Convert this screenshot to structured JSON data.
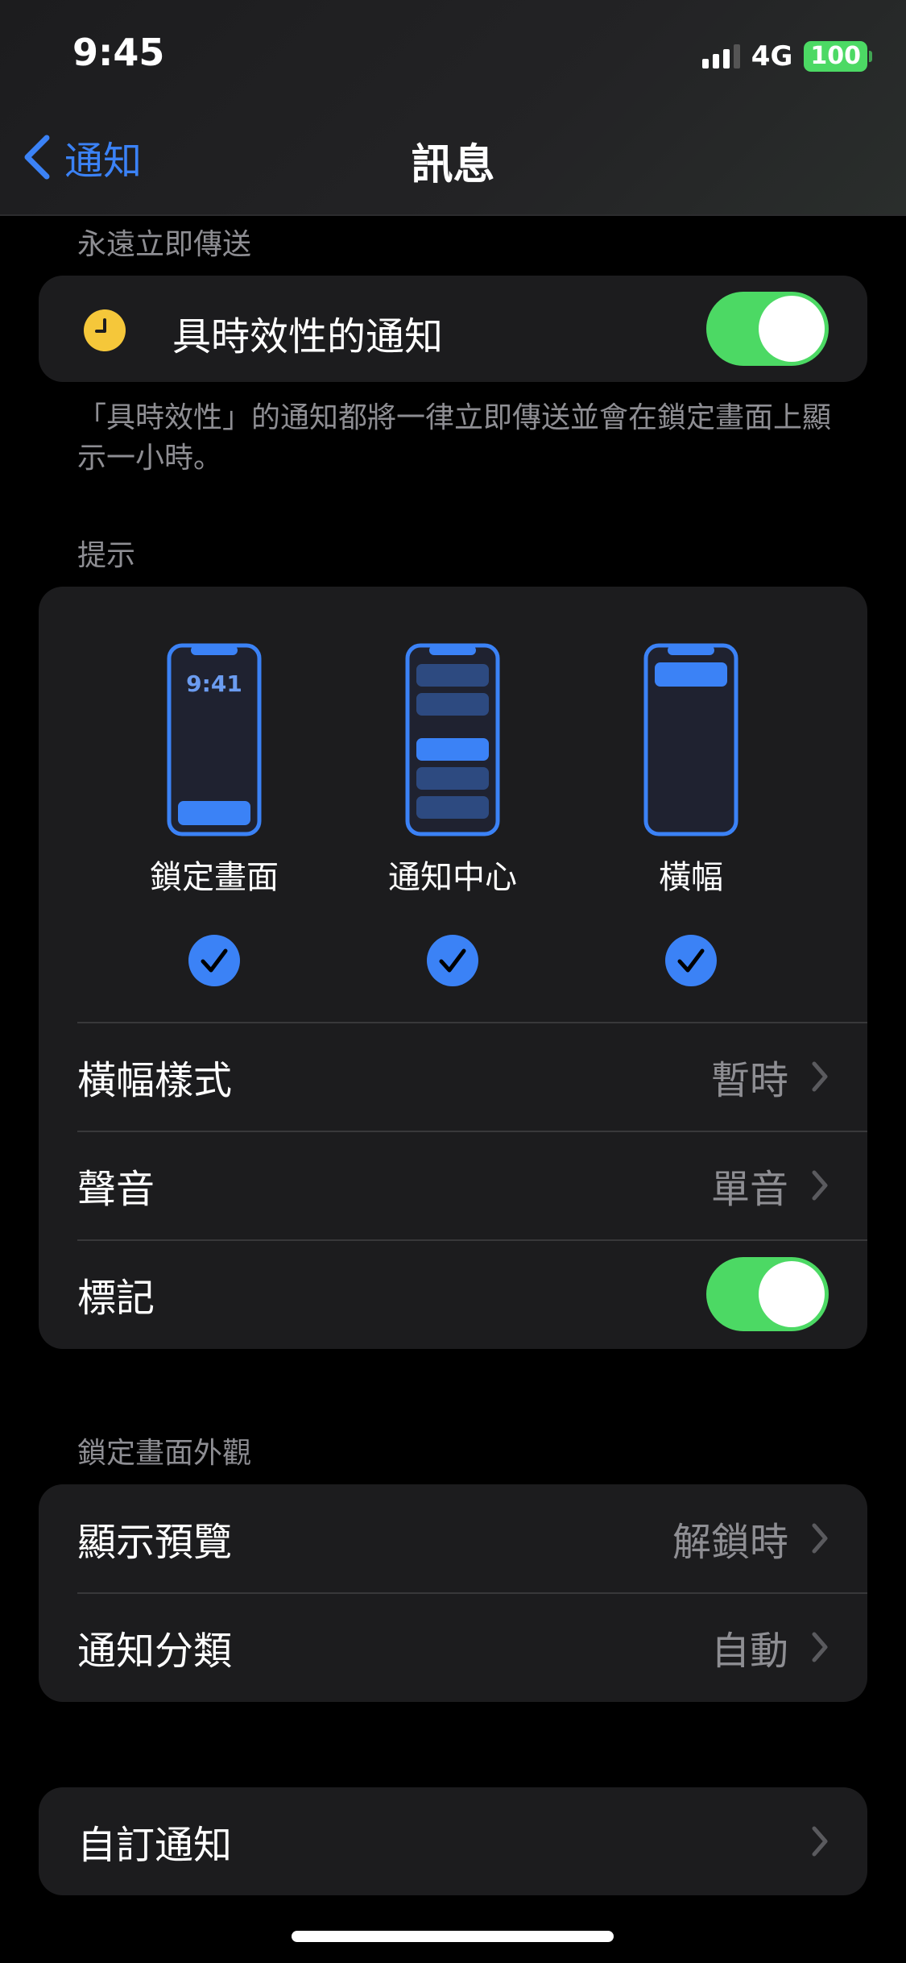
{
  "status_bar": {
    "time": "9:45",
    "network": "4G",
    "battery": "100"
  },
  "nav": {
    "back_label": "通知",
    "title": "訊息"
  },
  "immediate": {
    "header": "永遠立即傳送",
    "time_sensitive_label": "具時效性的通知",
    "time_sensitive_on": true,
    "footnote": "「具時效性」的通知都將一律立即傳送並會在鎖定畫面上顯示一小時。"
  },
  "alerts": {
    "header": "提示",
    "lock_time": "9:41",
    "options": [
      {
        "label": "鎖定畫面",
        "checked": true
      },
      {
        "label": "通知中心",
        "checked": true
      },
      {
        "label": "橫幅",
        "checked": true
      }
    ],
    "banner_style_label": "橫幅樣式",
    "banner_style_value": "暫時",
    "sound_label": "聲音",
    "sound_value": "單音",
    "badges_label": "標記",
    "badges_on": true
  },
  "lock_screen": {
    "header": "鎖定畫面外觀",
    "show_previews_label": "顯示預覽",
    "show_previews_value": "解鎖時",
    "grouping_label": "通知分類",
    "grouping_value": "自動"
  },
  "custom": {
    "label": "自訂通知"
  },
  "colors": {
    "accent": "#3b82f6",
    "toggle_on": "#4cd964",
    "card": "#1c1c1e",
    "secondary_text": "#8e8e93"
  }
}
